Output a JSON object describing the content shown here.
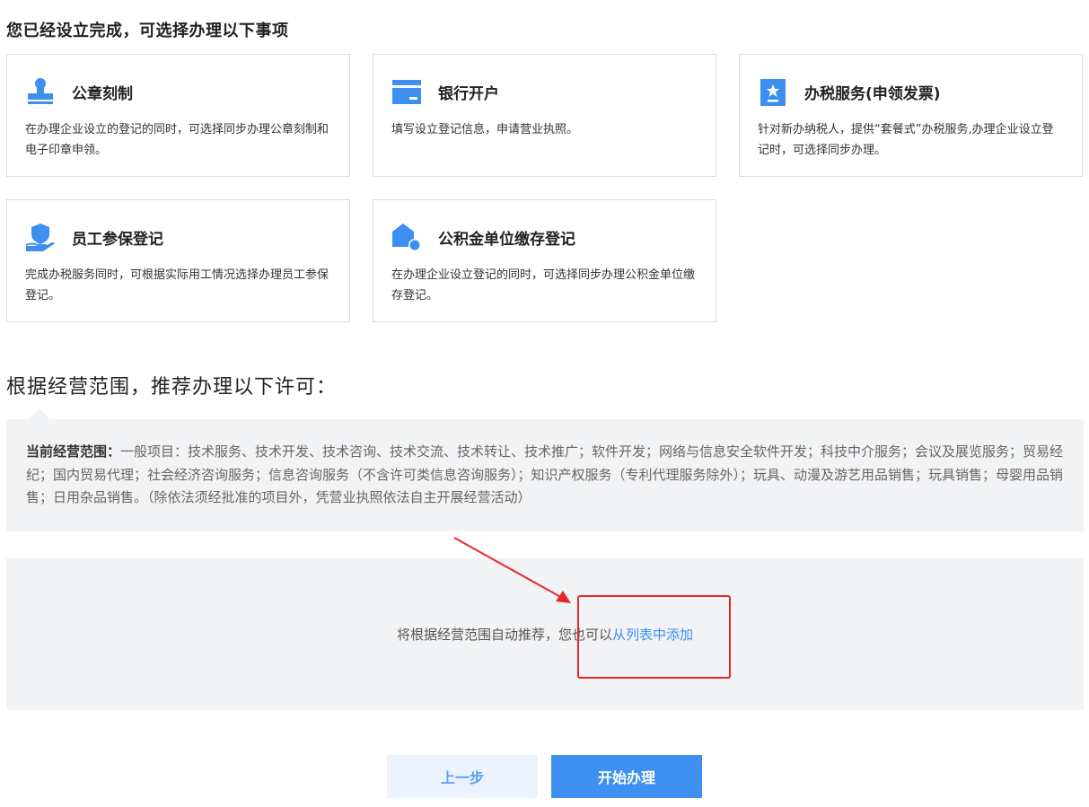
{
  "section1": {
    "title": "您已经设立完成，可选择办理以下事项"
  },
  "cards": [
    {
      "title": "公章刻制",
      "desc": "在办理企业设立的登记的同时，可选择同步办理公章刻制和电子印章申领。",
      "icon": "stamp-icon"
    },
    {
      "title": "银行开户",
      "desc": "填写设立登记信息，申请营业执照。",
      "icon": "bank-card-icon"
    },
    {
      "title": "办税服务(申领发票)",
      "desc": "针对新办纳税人，提供“套餐式”办税服务,办理企业设立登记时，可选择同步办理。",
      "icon": "tax-invoice-icon"
    },
    {
      "title": "员工参保登记",
      "desc": "完成办税服务同时，可根据实际用工情况选择办理员工参保登记。",
      "icon": "insurance-shield-icon"
    },
    {
      "title": "公积金单位缴存登记",
      "desc": "在办理企业设立登记的同时，可选择同步办理公积金单位缴存登记。",
      "icon": "housing-fund-icon"
    }
  ],
  "section2": {
    "title": "根据经营范围，推荐办理以下许可："
  },
  "scope": {
    "label": "当前经营范围：",
    "text": "一般项目：技术服务、技术开发、技术咨询、技术交流、技术转让、技术推广；软件开发；网络与信息安全软件开发；科技中介服务；会议及展览服务；贸易经纪；国内贸易代理；社会经济咨询服务；信息咨询服务（不含许可类信息咨询服务）；知识产权服务（专利代理服务除外）；玩具、动漫及游艺用品销售；玩具销售；母婴用品销售；日用杂品销售。（除依法须经批准的项目外，凭营业执照依法自主开展经营活动）"
  },
  "recommend": {
    "text": "将根据经营范围自动推荐，您也可以",
    "link": "从列表中添加"
  },
  "buttons": {
    "prev": "上一步",
    "start": "开始办理"
  },
  "colors": {
    "accent": "#3d8ff0",
    "annotation": "#e8262a",
    "panel": "#f2f3f5"
  }
}
